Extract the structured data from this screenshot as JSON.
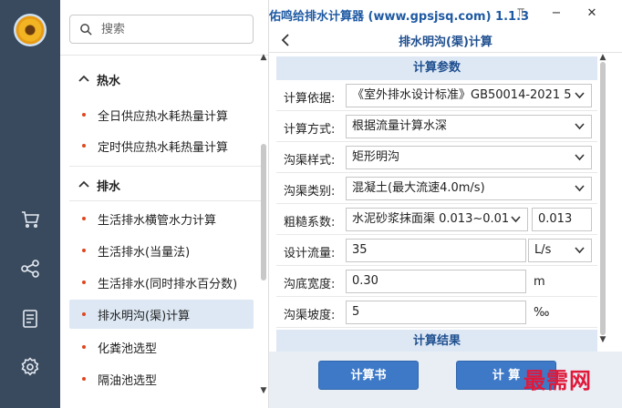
{
  "window": {
    "title": "佑鸣给排水计算器 (www.gpsjsq.com) 1.1.3",
    "pin_glyph": "⫪",
    "minimize_glyph": "−",
    "close_glyph": "✕"
  },
  "rail": {
    "icons": [
      "avatar",
      "cart-icon",
      "share-icon",
      "document-icon",
      "settings-icon"
    ]
  },
  "search": {
    "placeholder": "搜索",
    "value": ""
  },
  "menu": {
    "sections": [
      {
        "label": "热水",
        "items": [
          {
            "label": "全日供应热水耗热量计算"
          },
          {
            "label": "定时供应热水耗热量计算"
          }
        ]
      },
      {
        "label": "排水",
        "items": [
          {
            "label": "生活排水横管水力计算"
          },
          {
            "label": "生活排水(当量法)"
          },
          {
            "label": "生活排水(同时排水百分数)"
          },
          {
            "label": "排水明沟(渠)计算",
            "active": true
          },
          {
            "label": "化粪池选型"
          },
          {
            "label": "隔油池选型"
          }
        ]
      }
    ]
  },
  "nav": {
    "page_title": "排水明沟(渠)计算"
  },
  "form": {
    "params_header": "计算参数",
    "results_header": "计算结果",
    "rows": {
      "basis": {
        "label": "计算依据:",
        "value": "《室外排水设计标准》GB50014-2021 5"
      },
      "method": {
        "label": "计算方式:",
        "value": "根据流量计算水深"
      },
      "style": {
        "label": "沟渠样式:",
        "value": "矩形明沟"
      },
      "category": {
        "label": "沟渠类别:",
        "value": "混凝土(最大流速4.0m/s)"
      },
      "roughness": {
        "label": "粗糙系数:",
        "value": "水泥砂浆抹面渠 0.013~0.01",
        "number": "0.013"
      },
      "flow": {
        "label": "设计流量:",
        "value": "35",
        "unit": "L/s"
      },
      "width": {
        "label": "沟底宽度:",
        "value": "0.30",
        "unit": "m"
      },
      "slope": {
        "label": "沟渠坡度:",
        "value": "5",
        "unit": "‰"
      }
    }
  },
  "buttons": {
    "report": "计算书",
    "calculate": "计 算"
  },
  "watermark": "最需网"
}
